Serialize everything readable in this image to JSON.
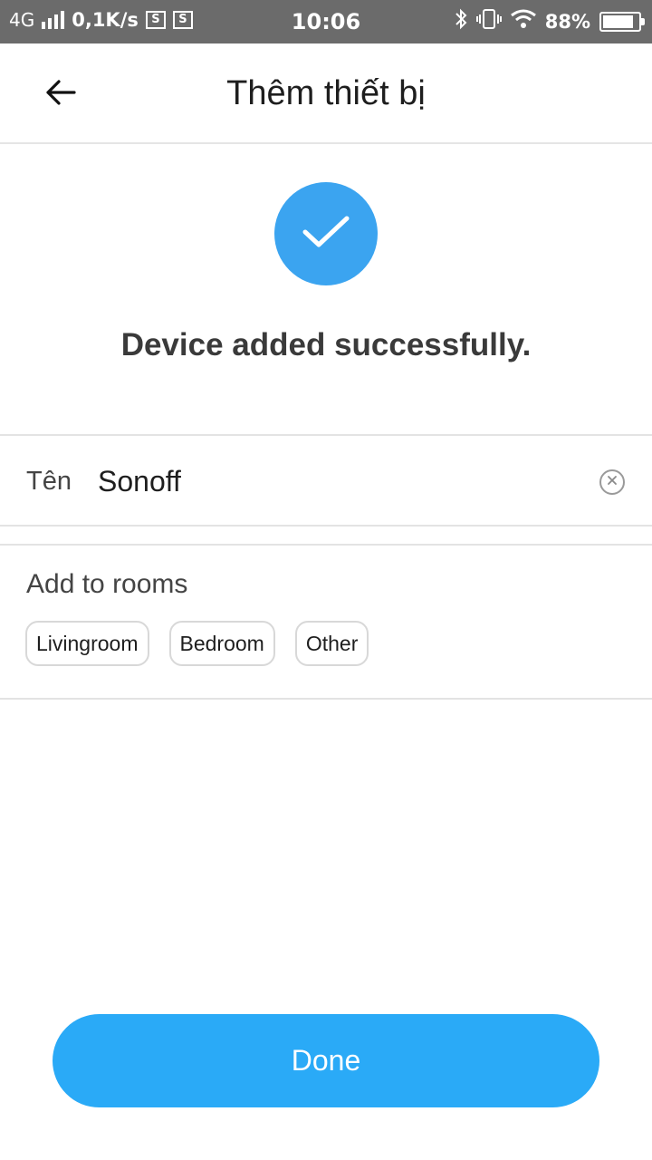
{
  "status_bar": {
    "network": "4G",
    "speed": "0,1K/s",
    "s_badge_1": "S",
    "s_badge_2": "S",
    "time": "10:06",
    "battery": "88%",
    "battery_level": 0.88,
    "icons": [
      "signal-icon",
      "s-notification-icon",
      "screenshot-icon",
      "bluetooth-icon",
      "vibrate-icon",
      "wifi-icon",
      "battery-icon"
    ]
  },
  "header": {
    "title": "Thêm thiết bị",
    "back_icon": "arrow-left-icon"
  },
  "success": {
    "icon": "checkmark-icon",
    "message": "Device added successfully."
  },
  "name_field": {
    "label": "Tên",
    "value": "Sonoff",
    "clear_icon": "clear-circle-icon"
  },
  "rooms": {
    "title": "Add to rooms",
    "options": [
      "Livingroom",
      "Bedroom",
      "Other"
    ]
  },
  "actions": {
    "done_label": "Done"
  },
  "colors": {
    "accent": "#2aaaf7",
    "success_circle": "#3ba4f0",
    "status_bar": "#6b6b6b"
  }
}
